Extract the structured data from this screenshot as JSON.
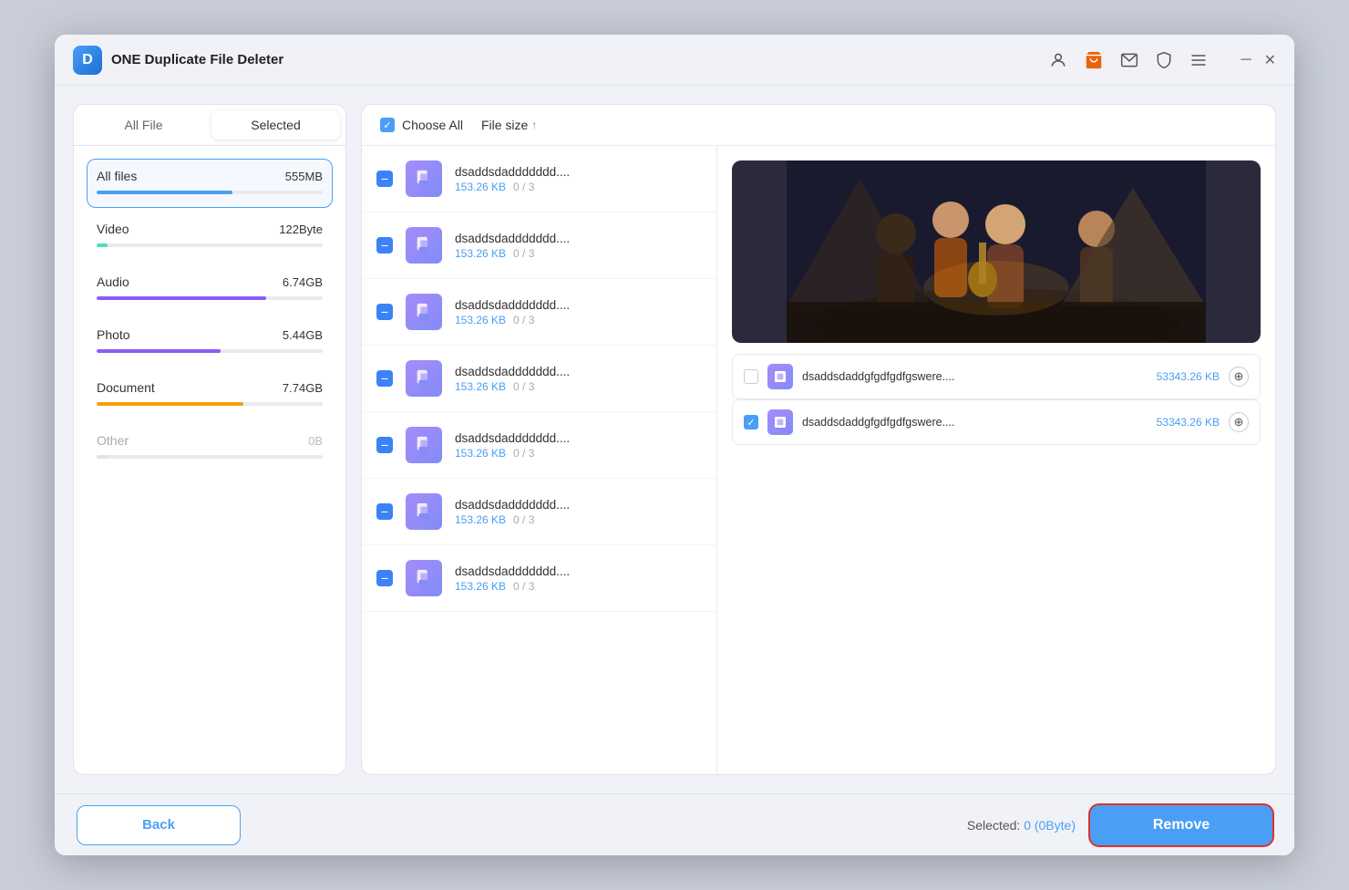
{
  "app": {
    "title": "ONE Duplicate File Deleter",
    "logo_letter": "D"
  },
  "titlebar": {
    "icons": [
      "user-icon",
      "cart-icon",
      "mail-icon",
      "shield-icon",
      "menu-icon"
    ],
    "window_controls": [
      "minimize-icon",
      "close-icon"
    ]
  },
  "tabs": {
    "all_file_label": "All File",
    "selected_label": "Selected"
  },
  "categories": [
    {
      "name": "All files",
      "size": "555MB",
      "color": "#4a9ff5",
      "width": "60%",
      "selected": true
    },
    {
      "name": "Video",
      "size": "122Byte",
      "color": "#4ae0c0",
      "width": "5%",
      "selected": false
    },
    {
      "name": "Audio",
      "size": "6.74GB",
      "color": "#8b5cf6",
      "width": "75%",
      "selected": false
    },
    {
      "name": "Photo",
      "size": "5.44GB",
      "color": "#8b5cf6",
      "width": "55%",
      "selected": false
    },
    {
      "name": "Document",
      "size": "7.74GB",
      "color": "#f59e0b",
      "width": "65%",
      "selected": false
    },
    {
      "name": "Other",
      "size": "0B",
      "color": "#e0e3ea",
      "width": "5%",
      "selected": false
    }
  ],
  "header": {
    "choose_all": "Choose All",
    "file_size": "File size",
    "sort_arrow": "↑"
  },
  "file_items": [
    {
      "name": "dsaddsdaddddddd....",
      "size": "153.26 KB",
      "count": "0 / 3"
    },
    {
      "name": "dsaddsdaddddddd....",
      "size": "153.26 KB",
      "count": "0 / 3"
    },
    {
      "name": "dsaddsdaddddddd....",
      "size": "153.26 KB",
      "count": "0 / 3"
    },
    {
      "name": "dsaddsdaddddddd....",
      "size": "153.26 KB",
      "count": "0 / 3"
    },
    {
      "name": "dsaddsdaddddddd....",
      "size": "153.26 KB",
      "count": "0 / 3"
    },
    {
      "name": "dsaddsdaddddddd....",
      "size": "153.26 KB",
      "count": "0 / 3"
    },
    {
      "name": "dsaddsdaddddddd....",
      "size": "153.26 KB",
      "count": "0 / 3"
    }
  ],
  "duplicate_files": [
    {
      "name": "dsaddsdaddgfgdfgdfgswere....",
      "size": "53343.26 KB",
      "checked": false
    },
    {
      "name": "dsaddsdaddgfgdfgdfgswere....",
      "size": "53343.26 KB",
      "checked": true
    }
  ],
  "bottom": {
    "back_label": "Back",
    "selected_prefix": "Selected:",
    "selected_count": "0 (0Byte)",
    "remove_label": "Remove"
  }
}
